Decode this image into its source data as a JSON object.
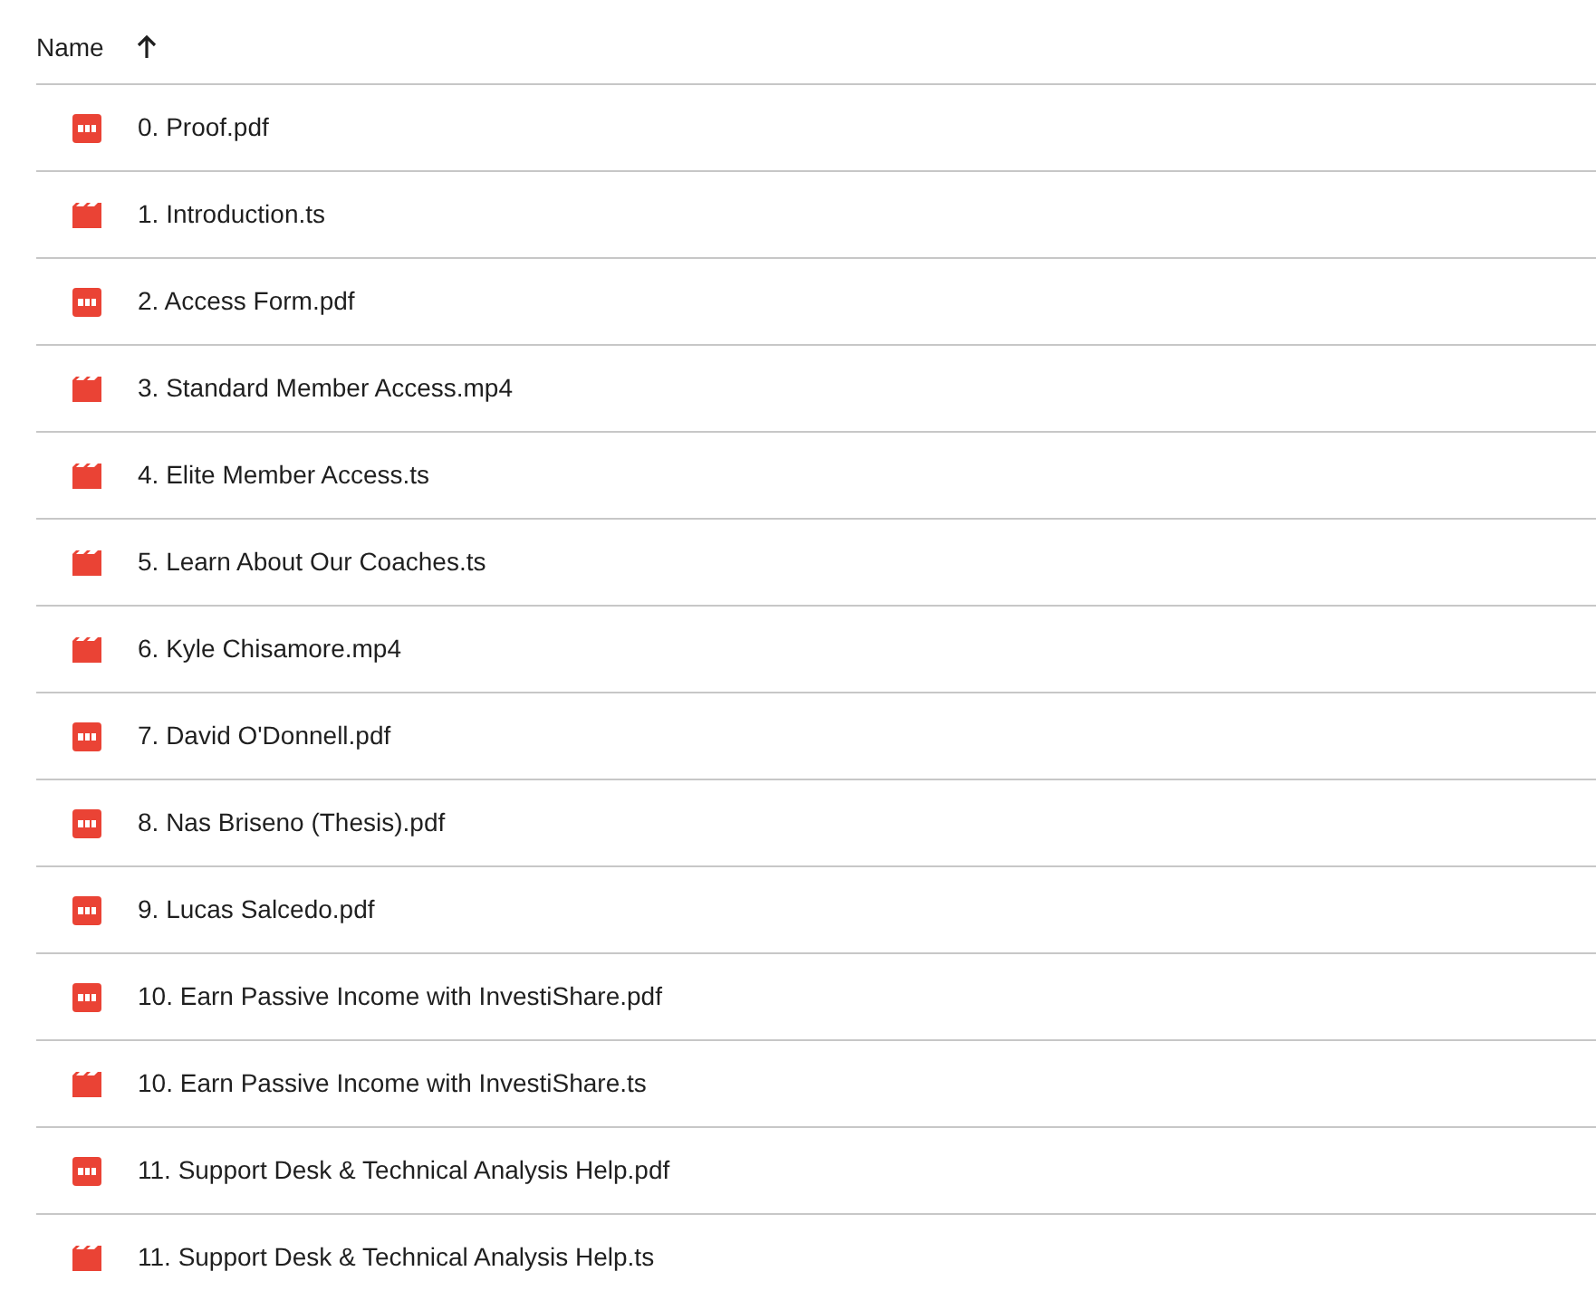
{
  "header": {
    "name_column": "Name"
  },
  "files": [
    {
      "kind": "pdf",
      "name": "0. Proof.pdf"
    },
    {
      "kind": "video",
      "name": "1. Introduction.ts"
    },
    {
      "kind": "pdf",
      "name": "2. Access Form.pdf"
    },
    {
      "kind": "video",
      "name": "3. Standard Member Access.mp4"
    },
    {
      "kind": "video",
      "name": "4. Elite Member Access.ts"
    },
    {
      "kind": "video",
      "name": "5. Learn About Our Coaches.ts"
    },
    {
      "kind": "video",
      "name": "6. Kyle Chisamore.mp4"
    },
    {
      "kind": "pdf",
      "name": "7. David O'Donnell.pdf"
    },
    {
      "kind": "pdf",
      "name": "8. Nas Briseno (Thesis).pdf"
    },
    {
      "kind": "pdf",
      "name": "9. Lucas Salcedo.pdf"
    },
    {
      "kind": "pdf",
      "name": "10. Earn Passive Income with InvestiShare.pdf"
    },
    {
      "kind": "video",
      "name": "10. Earn Passive Income with InvestiShare.ts"
    },
    {
      "kind": "pdf",
      "name": "11. Support Desk & Technical Analysis Help.pdf"
    },
    {
      "kind": "video",
      "name": "11. Support Desk & Technical Analysis Help.ts"
    }
  ]
}
